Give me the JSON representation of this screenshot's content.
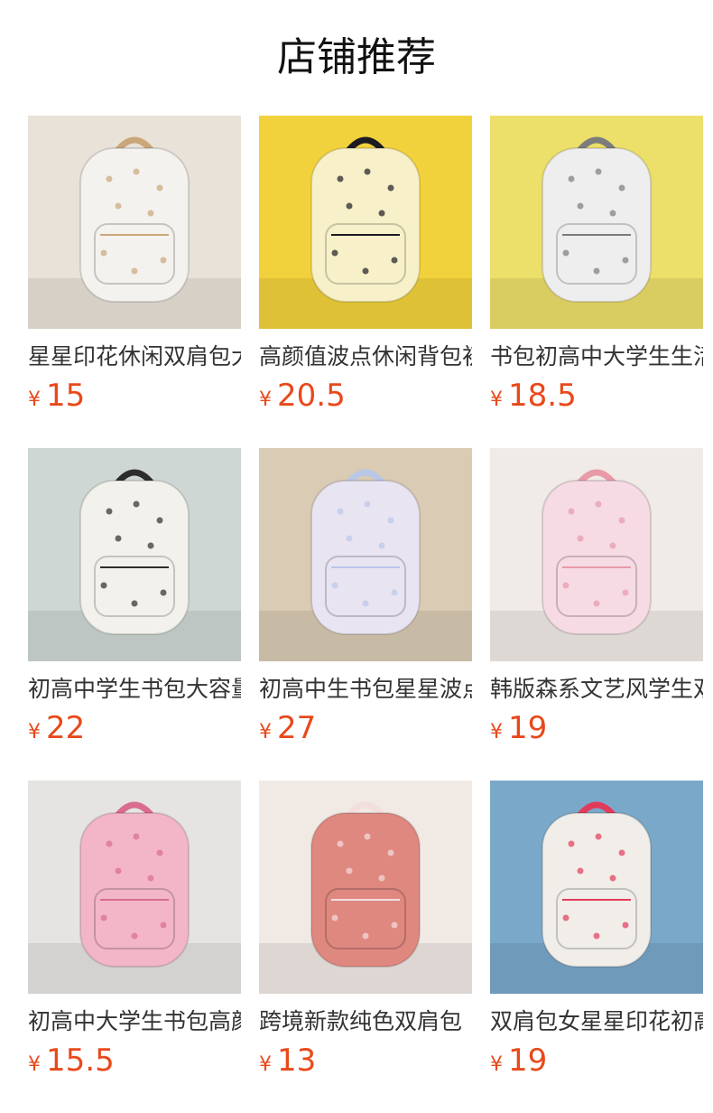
{
  "page": {
    "title": "店铺推荐"
  },
  "currency_symbol": "¥",
  "products": [
    {
      "name": "星星印花休闲双肩包大容量",
      "price": "15",
      "bg": "#e9e2d8",
      "bag": "#f4f2ee",
      "accent": "#c9a77a"
    },
    {
      "name": "高颜值波点休闲背包初中",
      "price": "20.5",
      "bg": "#f2d23c",
      "bag": "#f7f0c8",
      "accent": "#1b1b22"
    },
    {
      "name": "书包初高中大学生生活双肩包",
      "price": "18.5",
      "bg": "#ecdf6a",
      "bag": "#eeeeee",
      "accent": "#7c7c7c"
    },
    {
      "name": "初高中学生书包大容量",
      "price": "22",
      "bg": "#cfd7d4",
      "bag": "#f3f1ec",
      "accent": "#2c2c2c"
    },
    {
      "name": "初高中生书包星星波点",
      "price": "27",
      "bg": "#d9cbb4",
      "bag": "#e9e4f2",
      "accent": "#b9c7e8"
    },
    {
      "name": "韩版森系文艺风学生双肩包",
      "price": "19",
      "bg": "#f0ebe6",
      "bag": "#f6dbe4",
      "accent": "#e89aa9"
    },
    {
      "name": "初高中大学生书包高颜值",
      "price": "15.5",
      "bg": "#e6e4e2",
      "bag": "#f3b6c8",
      "accent": "#d96c8f"
    },
    {
      "name": "跨境新款纯色双肩包",
      "price": "13",
      "bg": "#f0e9e4",
      "bag": "#de8880",
      "accent": "#f3dede"
    },
    {
      "name": "双肩包女星星印花初高中",
      "price": "19",
      "bg": "#7aa8c9",
      "bag": "#f1eee9",
      "accent": "#e23b5a"
    }
  ]
}
